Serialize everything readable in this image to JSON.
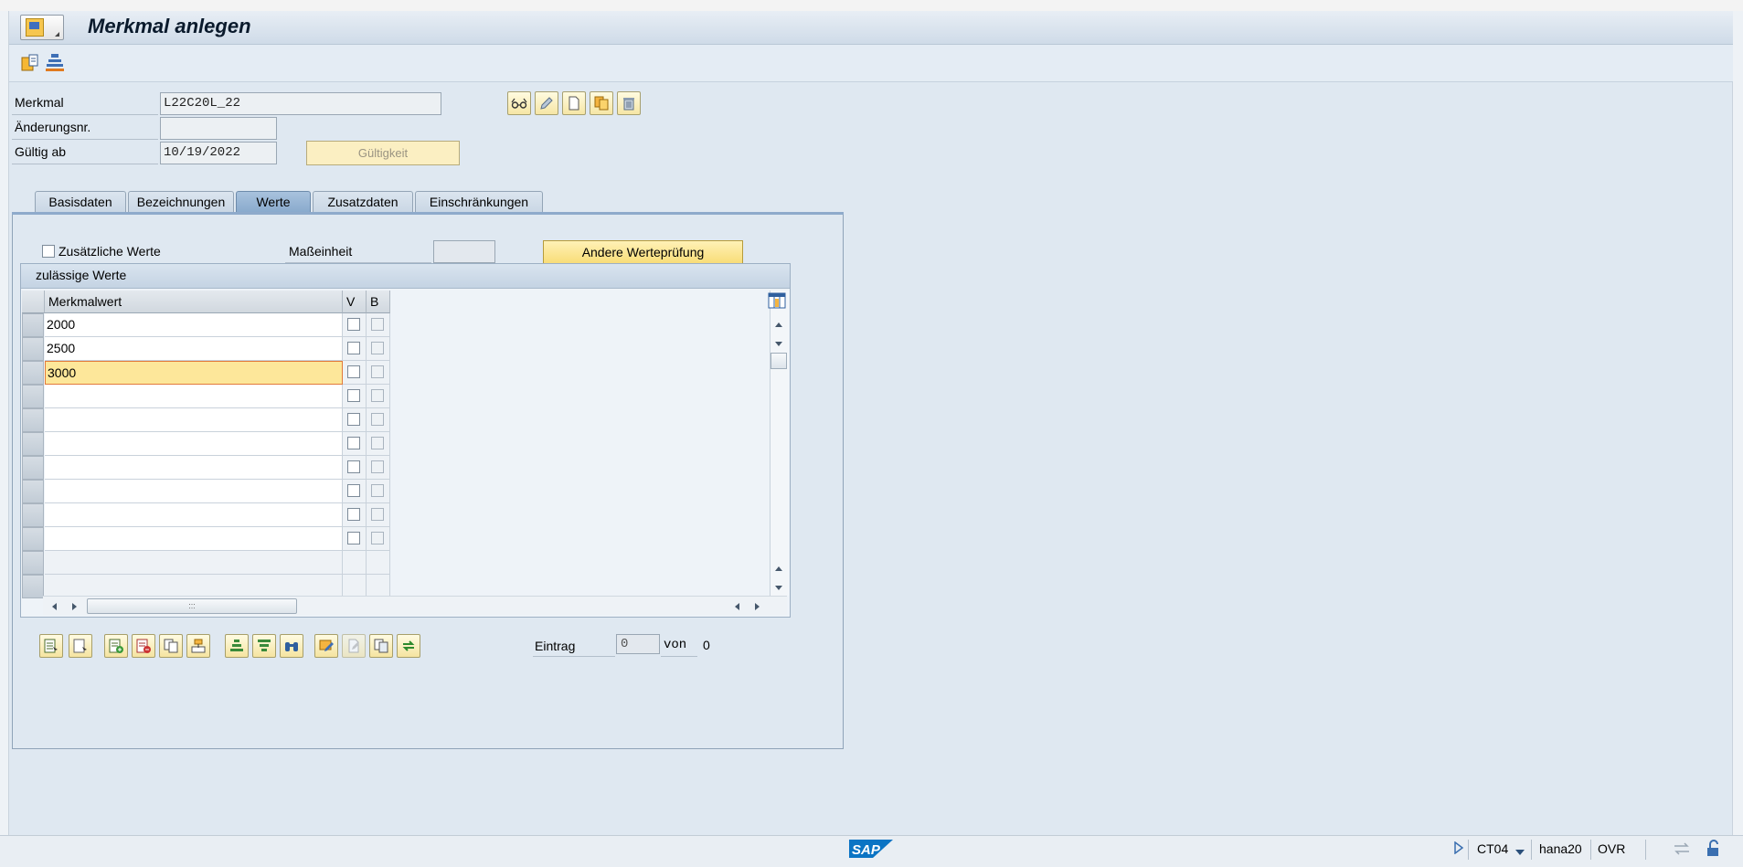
{
  "window": {
    "title": "Merkmal anlegen"
  },
  "header": {
    "merkmal_label": "Merkmal",
    "merkmal_value": "L22C20L_22",
    "aenderungsnr_label": "Änderungsnr.",
    "aenderungsnr_value": "",
    "gueltig_label": "Gültig ab",
    "gueltig_value": "10/19/2022",
    "gueltigkeit_button": "Gültigkeit"
  },
  "tabs": [
    {
      "label": "Basisdaten",
      "active": false
    },
    {
      "label": "Bezeichnungen",
      "active": false
    },
    {
      "label": "Werte",
      "active": true
    },
    {
      "label": "Zusatzdaten",
      "active": false
    },
    {
      "label": "Einschränkungen",
      "active": false
    }
  ],
  "werte": {
    "zusaetzliche_label": "Zusätzliche Werte",
    "zusaetzliche_checked": false,
    "masseinheit_label": "Maßeinheit",
    "masseinheit_value": "",
    "andere_button": "Andere Werteprüfung",
    "table_title": "zulässige Werte",
    "columns": [
      "Merkmalwert",
      "V",
      "B"
    ],
    "rows": [
      "2000",
      "2500",
      "3000",
      "",
      "",
      "",
      "",
      "",
      "",
      ""
    ],
    "active_row": 2
  },
  "footer": {
    "eintrag_label": "Eintrag",
    "eintrag_value": "0",
    "von_label": "von",
    "von_value": "0"
  },
  "statusbar": {
    "system": "CT04",
    "server": "hana20",
    "mode": "OVR",
    "logo": "SAP"
  },
  "colors": {
    "accent_yellow": "#f8dd78",
    "background": "#dfe8f1",
    "active_tab": "#88a9cc"
  }
}
